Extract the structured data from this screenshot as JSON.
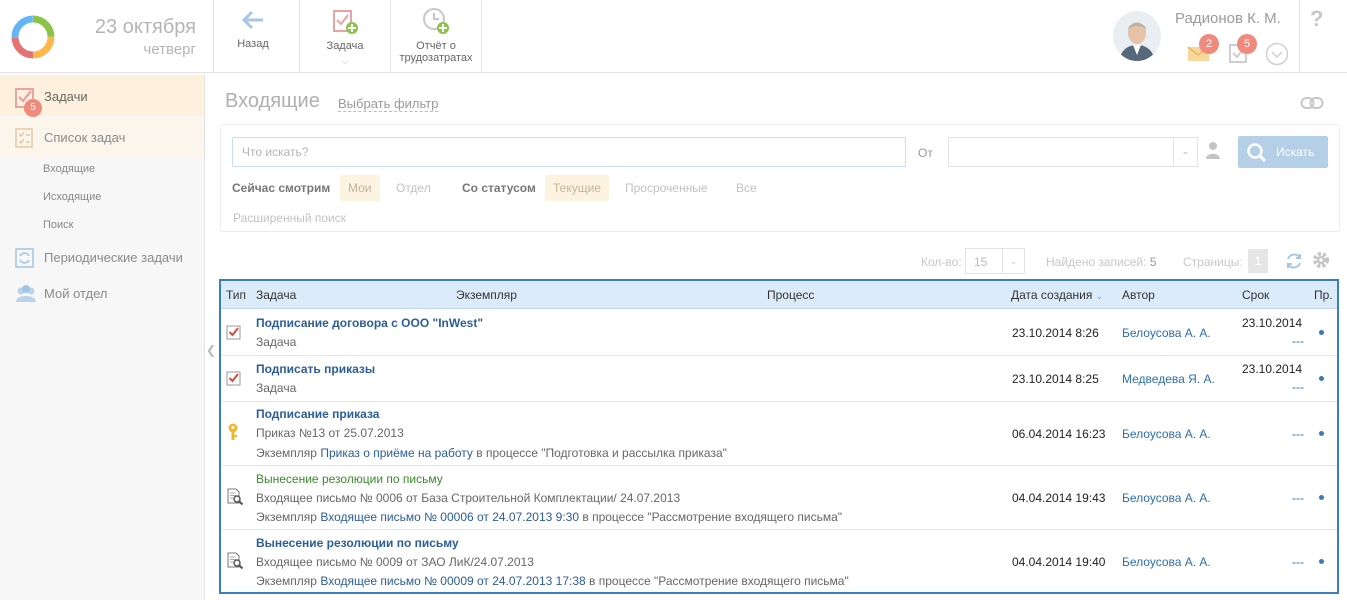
{
  "header": {
    "date_main": "23 октября",
    "date_weekday": "четверг",
    "back_label": "Назад",
    "task_label": "Задача",
    "report_label_1": "Отчёт о",
    "report_label_2": "трудозатратах",
    "user_name": "Радионов К. М.",
    "mail_badge": "2",
    "tasks_badge": "5",
    "help_icon": "?"
  },
  "sidebar": {
    "tasks": "Задачи",
    "tasks_badge": "5",
    "task_list": "Список задач",
    "sub_incoming": "Входящие",
    "sub_outgoing": "Исходящие",
    "sub_search": "Поиск",
    "periodic": "Периодические задачи",
    "my_department": "Мой отдел"
  },
  "page": {
    "title": "Входящие",
    "filter_link": "Выбрать фильтр"
  },
  "search": {
    "placeholder": "Что искать?",
    "from_label": "От",
    "button_label": "Искать",
    "now_viewing_label": "Сейчас смотрим",
    "view_options": [
      "Мои",
      "Отдел"
    ],
    "status_label": "Со статусом",
    "status_options": [
      "Текущие",
      "Просроченные",
      "Все"
    ],
    "advanced": "Расширенный поиск"
  },
  "pager": {
    "count_label": "Кол-во:",
    "count_value": "15",
    "found_label": "Найдено записей:",
    "found_value": "5",
    "pages_label": "Страницы:",
    "page_value": "1"
  },
  "table": {
    "columns": {
      "type": "Тип",
      "task": "Задача",
      "instance": "Экземпляр",
      "process": "Процесс",
      "created": "Дата создания",
      "author": "Автор",
      "deadline": "Срок",
      "priority": "Пр."
    },
    "rows": [
      {
        "icon": "task-check-icon",
        "title": "Подписание договора с ООО \"InWest\"",
        "line2": "Задача",
        "line3_prefix": "",
        "line3_link": "",
        "line3_suffix": "",
        "created": "23.10.2014 8:26",
        "author": "Белоусова А. А.",
        "deadline": "23.10.2014",
        "deadline_dash": "---"
      },
      {
        "icon": "task-check-icon",
        "title": "Подписать приказы",
        "line2": "Задача",
        "line3_prefix": "",
        "line3_link": "",
        "line3_suffix": "",
        "created": "23.10.2014 8:25",
        "author": "Медведева Я. А.",
        "deadline": "23.10.2014",
        "deadline_dash": "---"
      },
      {
        "icon": "key-icon",
        "title": "Подписание приказа",
        "line2": "Приказ №13 от 25.07.2013",
        "line3_prefix": "Экземпляр",
        "line3_link": "Приказ о приёме на работу",
        "line3_suffix": "в процессе \"Подготовка и рассылка приказа\"",
        "created": "06.04.2014 16:23",
        "author": "Белоусова А. А.",
        "deadline": "",
        "deadline_dash": "---"
      },
      {
        "icon": "document-search-icon",
        "title": "Вынесение резолюции по письму",
        "line2": "Входящее письмо № 0006 от База Строительной Комплектации/ 24.07.2013",
        "line3_prefix": "Экземпляр",
        "line3_link": "Входящее письмо № 00006 от 24.07.2013 9:30",
        "line3_suffix": "в процессе \"Рассмотрение входящего письма\"",
        "created": "04.04.2014 19:43",
        "author": "Белоусова А. А.",
        "deadline": "",
        "deadline_dash": "---"
      },
      {
        "icon": "document-search-icon",
        "title": "Вынесение резолюции по письму",
        "line2": "Входящее письмо № 0009 от ЗАО ЛиК/24.07.2013",
        "line3_prefix": "Экземпляр",
        "line3_link": "Входящее письмо № 00009 от 24.07.2013 17:38",
        "line3_suffix": "в процессе \"Рассмотрение входящего письма\"",
        "created": "04.04.2014 19:40",
        "author": "Белоусова А. А.",
        "deadline": "",
        "deadline_dash": "---"
      }
    ]
  }
}
